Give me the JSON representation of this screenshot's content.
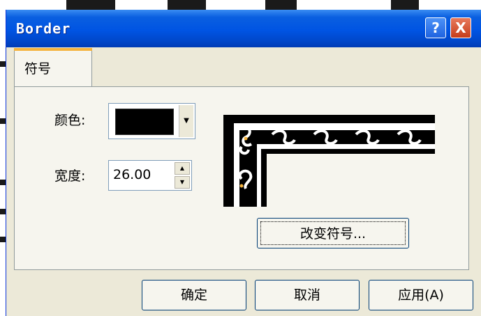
{
  "window": {
    "title": "Border"
  },
  "caption_buttons": {
    "help_label": "?",
    "close_label": "X"
  },
  "tabs": [
    {
      "label": "符号",
      "selected": true
    }
  ],
  "fields": {
    "color": {
      "label": "颜色:",
      "value_hex": "#000000"
    },
    "width": {
      "label": "宽度:",
      "value": "26.00"
    }
  },
  "preview": {
    "icon": "celtic-knot-border-preview"
  },
  "change_symbol_button": {
    "label": "改变符号..."
  },
  "footer": {
    "ok_label": "确定",
    "cancel_label": "取消",
    "apply_label": "应用(A)"
  },
  "colors": {
    "title_bar": "#0054e3",
    "window_bg": "#ece9d8",
    "panel_bg": "#f6f5ee",
    "tab_highlight": "#f5b33c",
    "close_button": "#c63d1a"
  }
}
